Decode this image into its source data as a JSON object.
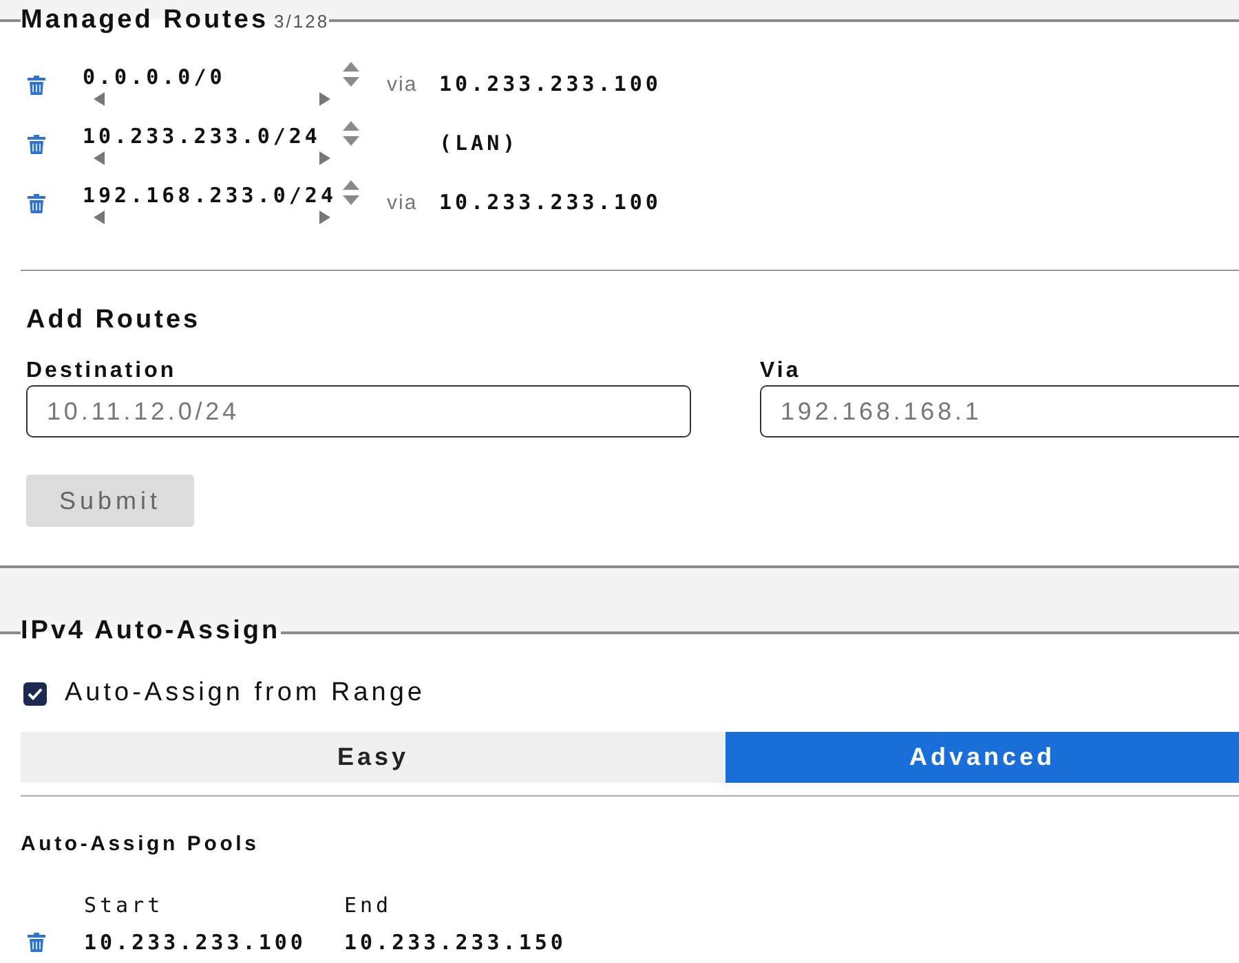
{
  "managed_routes": {
    "title": "Managed Routes",
    "count": "3/128",
    "routes": [
      {
        "destination": "0.0.0.0/0",
        "via_label": "via",
        "via": "10.233.233.100"
      },
      {
        "destination": "10.233.233.0/24",
        "via": "(LAN)"
      },
      {
        "destination": "192.168.233.0/24",
        "via_label": "via",
        "via": "10.233.233.100"
      }
    ]
  },
  "add_routes": {
    "title": "Add Routes",
    "fields": [
      {
        "label": "Destination",
        "placeholder": "10.11.12.0/24"
      },
      {
        "label": "Via",
        "placeholder": "192.168.168.1"
      }
    ],
    "submit": {
      "label": "Submit",
      "disabled": true
    }
  },
  "ipv4_auto_assign": {
    "title": "IPv4 Auto-Assign",
    "auto_assign": {
      "label": "Auto-Assign from Range",
      "checked": true
    },
    "mode_tabs": [
      {
        "label": "Easy",
        "selected": false
      },
      {
        "label": "Advanced",
        "selected": true
      }
    ],
    "pools": {
      "title": "Auto-Assign Pools",
      "columns": [
        "Start",
        "End"
      ],
      "rows": [
        {
          "start": "10.233.233.100",
          "end": "10.233.233.150"
        }
      ]
    }
  }
}
